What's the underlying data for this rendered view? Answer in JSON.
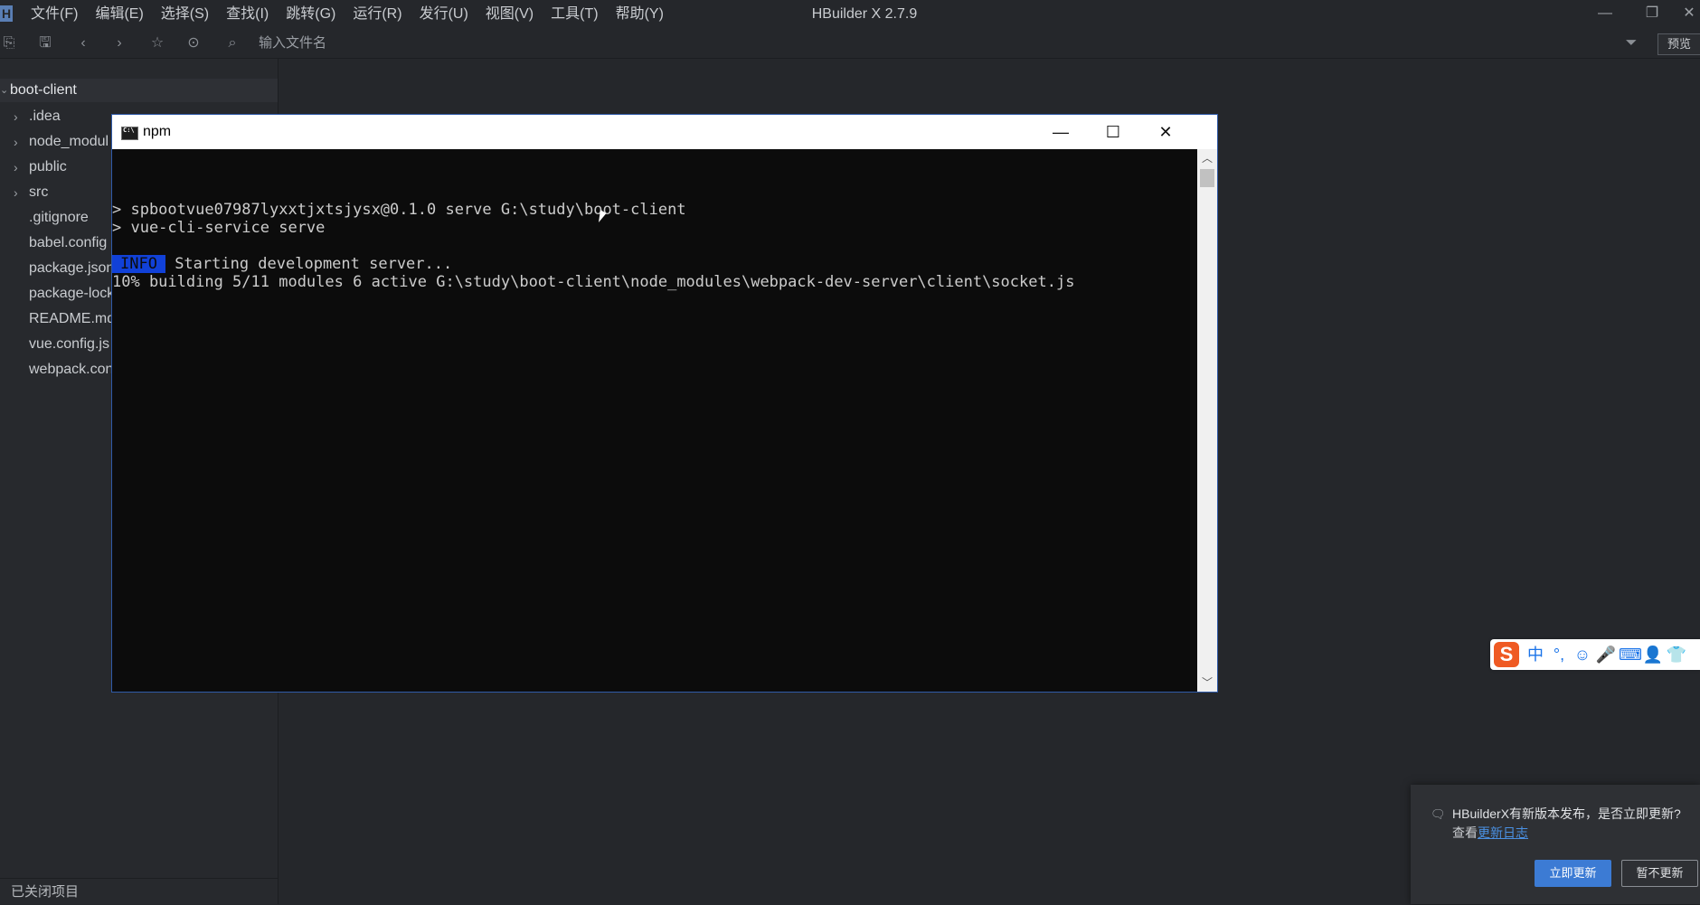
{
  "app": {
    "title": "HBuilder X 2.7.9",
    "logo_letter": "H"
  },
  "menu": [
    {
      "label": "文件(F)"
    },
    {
      "label": "编辑(E)"
    },
    {
      "label": "选择(S)"
    },
    {
      "label": "查找(I)"
    },
    {
      "label": "跳转(G)"
    },
    {
      "label": "运行(R)"
    },
    {
      "label": "发行(U)"
    },
    {
      "label": "视图(V)"
    },
    {
      "label": "工具(T)"
    },
    {
      "label": "帮助(Y)"
    }
  ],
  "window_controls": {
    "minimize": "—",
    "restore": "❐",
    "close": "✕"
  },
  "toolbar": {
    "file_search_placeholder": "输入文件名",
    "preview_label": "预览",
    "icons": [
      "new-file-icon",
      "save-icon",
      "back-icon",
      "forward-icon",
      "star-icon",
      "run-icon",
      "browser-icon",
      "filter-icon"
    ]
  },
  "sidebar": {
    "project": "boot-client",
    "items": [
      {
        "label": ".idea",
        "folder": true
      },
      {
        "label": "node_modul",
        "folder": true
      },
      {
        "label": "public",
        "folder": true
      },
      {
        "label": "src",
        "folder": true
      },
      {
        "label": ".gitignore",
        "folder": false
      },
      {
        "label": "babel.config",
        "folder": false
      },
      {
        "label": "package.json",
        "folder": false
      },
      {
        "label": "package-lock",
        "folder": false
      },
      {
        "label": "README.md",
        "folder": false
      },
      {
        "label": "vue.config.js",
        "folder": false
      },
      {
        "label": "webpack.con",
        "folder": false
      }
    ],
    "closed_projects": "已关闭项目"
  },
  "console": {
    "title": "npm",
    "controls": {
      "minimize": "—",
      "maximize": "☐",
      "close": "✕"
    },
    "lines": [
      "> spbootvue07987lyxxtjxtsjysx@0.1.0 serve G:\\study\\boot-client",
      "> vue-cli-service serve"
    ],
    "info_badge": "INFO",
    "info_text": " Starting development server...",
    "progress_line": "10% building 5/11 modules 6 active G:\\study\\boot-client\\node_modules\\webpack-dev-server\\client\\socket.js"
  },
  "ime": {
    "logo": "S",
    "items": [
      {
        "icon": "chinese-mode-icon",
        "glyph": "中"
      },
      {
        "icon": "punctuation-icon",
        "glyph": "°,"
      },
      {
        "icon": "emoji-icon",
        "glyph": "☺"
      },
      {
        "icon": "microphone-icon",
        "glyph": "🎤"
      },
      {
        "icon": "keyboard-icon",
        "glyph": "⌨"
      },
      {
        "icon": "user-icon",
        "glyph": "👤"
      },
      {
        "icon": "skin-icon",
        "glyph": "👕"
      }
    ]
  },
  "notification": {
    "message": "HBuilderX有新版本发布，是否立即更新?",
    "sub_prefix": "查看",
    "link_text": "更新日志",
    "update_button": "立即更新",
    "later_button": "暂不更新"
  },
  "colors": {
    "background": "#25272b",
    "console_bg": "#0c0c0c",
    "info_badge": "#1141d8",
    "accent": "#3c7bd4"
  }
}
